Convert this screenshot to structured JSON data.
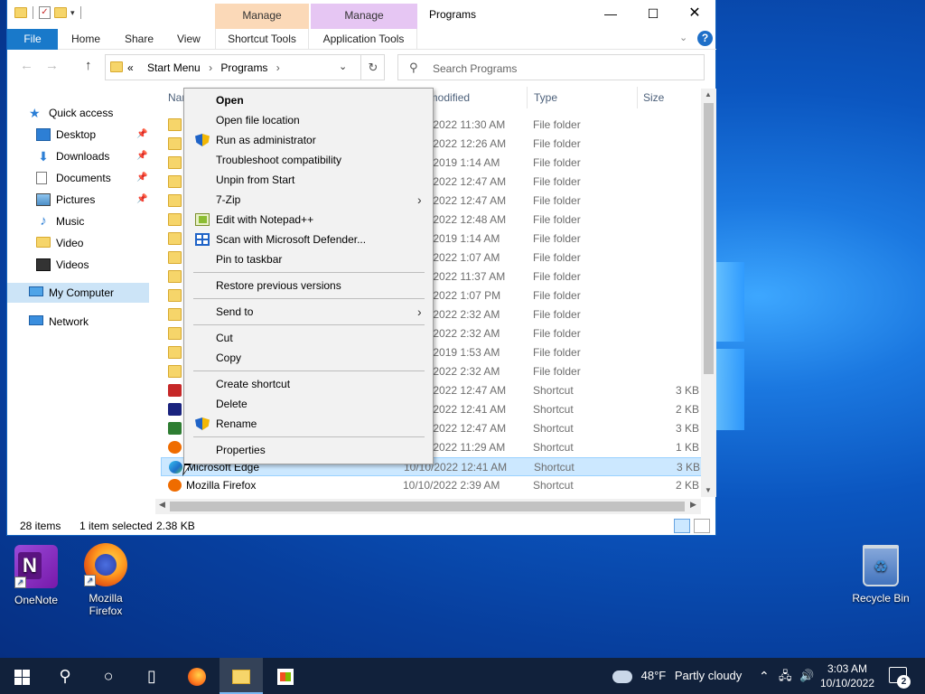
{
  "window": {
    "title": "Programs",
    "manage_tab_1": "Manage",
    "manage_tab_2": "Manage",
    "controls": {
      "minimize": "—",
      "maximize": "☐",
      "close": "✕"
    }
  },
  "ribbon": {
    "file": "File",
    "home": "Home",
    "share": "Share",
    "view": "View",
    "shortcut_tools": "Shortcut Tools",
    "application_tools": "Application Tools"
  },
  "address": {
    "prefix": "«",
    "crumbs": [
      "Start Menu",
      "Programs"
    ],
    "search_placeholder": "Search Programs"
  },
  "nav": {
    "quick_access": "Quick access",
    "items": [
      "Desktop",
      "Downloads",
      "Documents",
      "Pictures",
      "Music",
      "Video",
      "Videos"
    ],
    "my_computer": "My Computer",
    "network": "Network"
  },
  "columns": {
    "name": "Name",
    "modified": "Date modified",
    "type": "Type",
    "size": "Size"
  },
  "rows": [
    {
      "name": "",
      "date": "10/10/2022 11:30 AM",
      "type": "File folder",
      "size": ""
    },
    {
      "name": "",
      "date": "10/10/2022 12:26 AM",
      "type": "File folder",
      "size": ""
    },
    {
      "name": "",
      "date": "10/10/2019 1:14 AM",
      "type": "File folder",
      "size": ""
    },
    {
      "name": "",
      "date": "10/10/2022 12:47 AM",
      "type": "File folder",
      "size": ""
    },
    {
      "name": "",
      "date": "10/10/2022 12:47 AM",
      "type": "File folder",
      "size": ""
    },
    {
      "name": "",
      "date": "10/10/2022 12:48 AM",
      "type": "File folder",
      "size": ""
    },
    {
      "name": "",
      "date": "10/10/2019 1:14 AM",
      "type": "File folder",
      "size": ""
    },
    {
      "name": "",
      "date": "10/10/2022 1:07 AM",
      "type": "File folder",
      "size": ""
    },
    {
      "name": "",
      "date": "10/10/2022 11:37 AM",
      "type": "File folder",
      "size": ""
    },
    {
      "name": "",
      "date": "10/10/2022 1:07 PM",
      "type": "File folder",
      "size": ""
    },
    {
      "name": "",
      "date": "10/10/2022 2:32 AM",
      "type": "File folder",
      "size": ""
    },
    {
      "name": "",
      "date": "10/10/2022 2:32 AM",
      "type": "File folder",
      "size": ""
    },
    {
      "name": "",
      "date": "10/10/2019 1:53 AM",
      "type": "File folder",
      "size": ""
    },
    {
      "name": "",
      "date": "10/10/2022 2:32 AM",
      "type": "File folder",
      "size": ""
    },
    {
      "name": "",
      "date": "10/10/2022 12:47 AM",
      "type": "Shortcut",
      "size": "3 KB"
    },
    {
      "name": "",
      "date": "10/10/2022 12:41 AM",
      "type": "Shortcut",
      "size": "2 KB"
    },
    {
      "name": "",
      "date": "10/10/2022 12:47 AM",
      "type": "Shortcut",
      "size": "3 KB"
    },
    {
      "name": "",
      "date": "10/10/2022 11:29 AM",
      "type": "Shortcut",
      "size": "1 KB"
    },
    {
      "name": "Microsoft Edge",
      "date": "10/10/2022 12:41 AM",
      "type": "Shortcut",
      "size": "3 KB"
    },
    {
      "name": "Mozilla Firefox",
      "date": "10/10/2022 2:39 AM",
      "type": "Shortcut",
      "size": "2 KB"
    }
  ],
  "status": {
    "count": "28 items",
    "selected": "1 item selected",
    "size": "2.38 KB"
  },
  "context_menu": {
    "open": "Open",
    "open_location": "Open file location",
    "run_admin": "Run as administrator",
    "troubleshoot": "Troubleshoot compatibility",
    "unpin": "Unpin from Start",
    "sevenzip": "7-Zip",
    "notepadpp": "Edit with Notepad++",
    "defender": "Scan with Microsoft Defender...",
    "pin_taskbar": "Pin to taskbar",
    "restore": "Restore previous versions",
    "send_to": "Send to",
    "cut": "Cut",
    "copy": "Copy",
    "create_shortcut": "Create shortcut",
    "delete": "Delete",
    "rename": "Rename",
    "properties": "Properties"
  },
  "desktop": {
    "onenote": "OneNote",
    "firefox_line1": "Mozilla",
    "firefox_line2": "Firefox",
    "recycle": "Recycle Bin"
  },
  "taskbar": {
    "temperature": "48°F",
    "weather": "Partly cloudy",
    "time": "3:03 AM",
    "date": "10/10/2022",
    "notifications": "2"
  }
}
